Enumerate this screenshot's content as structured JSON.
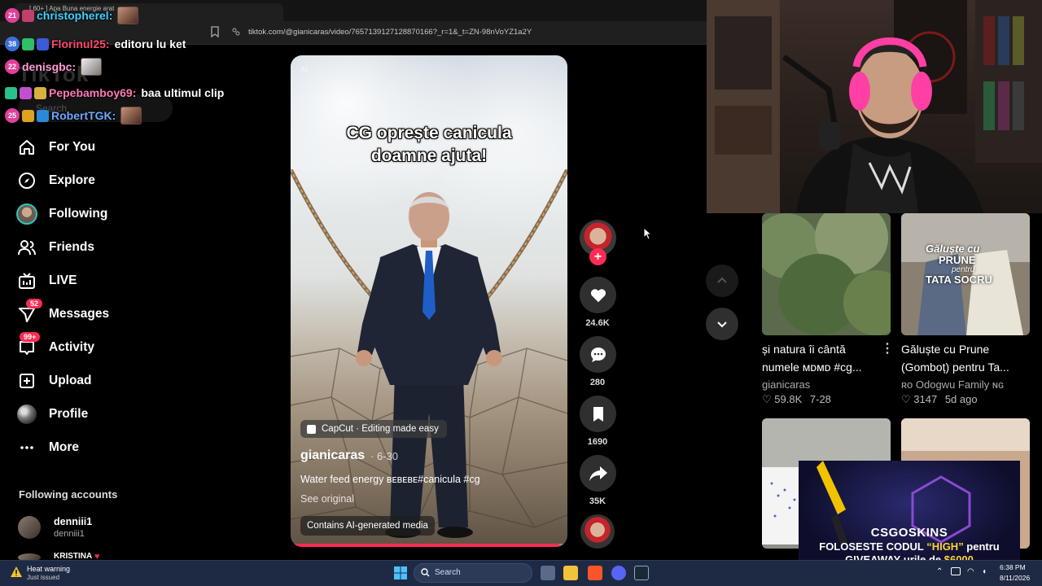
{
  "browser": {
    "tab_title": "[ 60+ ] Apa Buna energie arat",
    "url": "tiktok.com/@gianicaras/video/7657139127128870166?_r=1&_t=ZN-98nVoYZ1a2Y"
  },
  "chat": [
    {
      "level": "21",
      "level_color": "#e0409a",
      "username": "christopherel:",
      "name_color": "#3fd0ff",
      "message": "",
      "emote": true
    },
    {
      "level": "38",
      "level_color": "#3b6fd8",
      "username": "Florinul25:",
      "name_color": "#ff4a6e",
      "message": "editoru lu ket",
      "emote": false
    },
    {
      "level": "22",
      "level_color": "#e0409a",
      "username": "denisgbc:",
      "name_color": "#ff9ad8",
      "message": "",
      "emote": true
    },
    {
      "level": "",
      "level_color": "#29c08a",
      "username": "Pepebamboy69:",
      "name_color": "#ff7ab8",
      "message": "baa ultimul clip",
      "emote": false
    },
    {
      "level": "25",
      "level_color": "#e0409a",
      "username": "RobertTGK:",
      "name_color": "#6fa8ff",
      "message": "",
      "emote": true
    }
  ],
  "tiktok": {
    "logo": "TikTok",
    "search_placeholder": "Search",
    "nav": [
      {
        "label": "For You",
        "icon": "home-icon",
        "badge": ""
      },
      {
        "label": "Explore",
        "icon": "compass-icon",
        "badge": ""
      },
      {
        "label": "Following",
        "icon": "following-avatar-icon",
        "badge": ""
      },
      {
        "label": "Friends",
        "icon": "friends-icon",
        "badge": ""
      },
      {
        "label": "LIVE",
        "icon": "live-tv-icon",
        "badge": ""
      },
      {
        "label": "Messages",
        "icon": "paper-plane-icon",
        "badge": "52"
      },
      {
        "label": "Activity",
        "icon": "chat-bubble-icon",
        "badge": "99+"
      },
      {
        "label": "Upload",
        "icon": "plus-square-icon",
        "badge": ""
      },
      {
        "label": "Profile",
        "icon": "profile-avatar-icon",
        "badge": ""
      },
      {
        "label": "More",
        "icon": "more-dots-icon",
        "badge": ""
      }
    ],
    "following_heading": "Following accounts",
    "following_accounts": [
      {
        "name": "denniii1",
        "handle": "denniii1"
      },
      {
        "name": "KRISTINA",
        "handle": ""
      }
    ]
  },
  "video": {
    "ai_tag": "AI",
    "caption_line1": "CG oprește canicula",
    "caption_line2": "doamne ajuta!",
    "capcut_label": "CapCut · Editing made easy",
    "author": "gianicaras",
    "date": "· 6-30",
    "description": "Water feed energy ʙᴇʙᴇʙᴇ#canicula #cg",
    "see_original": "See original",
    "ai_notice": "Contains AI-generated media",
    "progress": 0.97
  },
  "actions": {
    "likes": "24.6K",
    "comments": "280",
    "saves": "1690",
    "shares": "35K"
  },
  "recommended": [
    {
      "title_line1": "și natura îi cântă",
      "title_line2": "numele ᴍᴅᴍᴅ #cg...",
      "author": "gianicaras",
      "likes": "59.8K",
      "date": "7-28"
    },
    {
      "title_line1": "Găluște cu Prune",
      "title_line2": "(Gomboț) pentru Ta...",
      "author": "ʀᴏ Odogwu Family ɴɢ",
      "likes": "3147",
      "date": "5d ago",
      "thumb_text1": "Găluște cu",
      "thumb_text2": "PRUNE",
      "thumb_text3": "pentru",
      "thumb_text4": "TATA SOCRU"
    }
  ],
  "ad": {
    "brand": "CSGOSKINS",
    "line1_pre": "FOLOSESTE CODUL ",
    "line1_code": "“HIGH”",
    "line1_post": " pentru",
    "line2_pre": "GIVEAWAY-urile de ",
    "line2_amount": "$6000"
  },
  "taskbar": {
    "weather_title": "Heat warning",
    "weather_sub": "Just issued",
    "search_label": "Search",
    "time": "6:38 PM",
    "date": "8/11/2026"
  }
}
